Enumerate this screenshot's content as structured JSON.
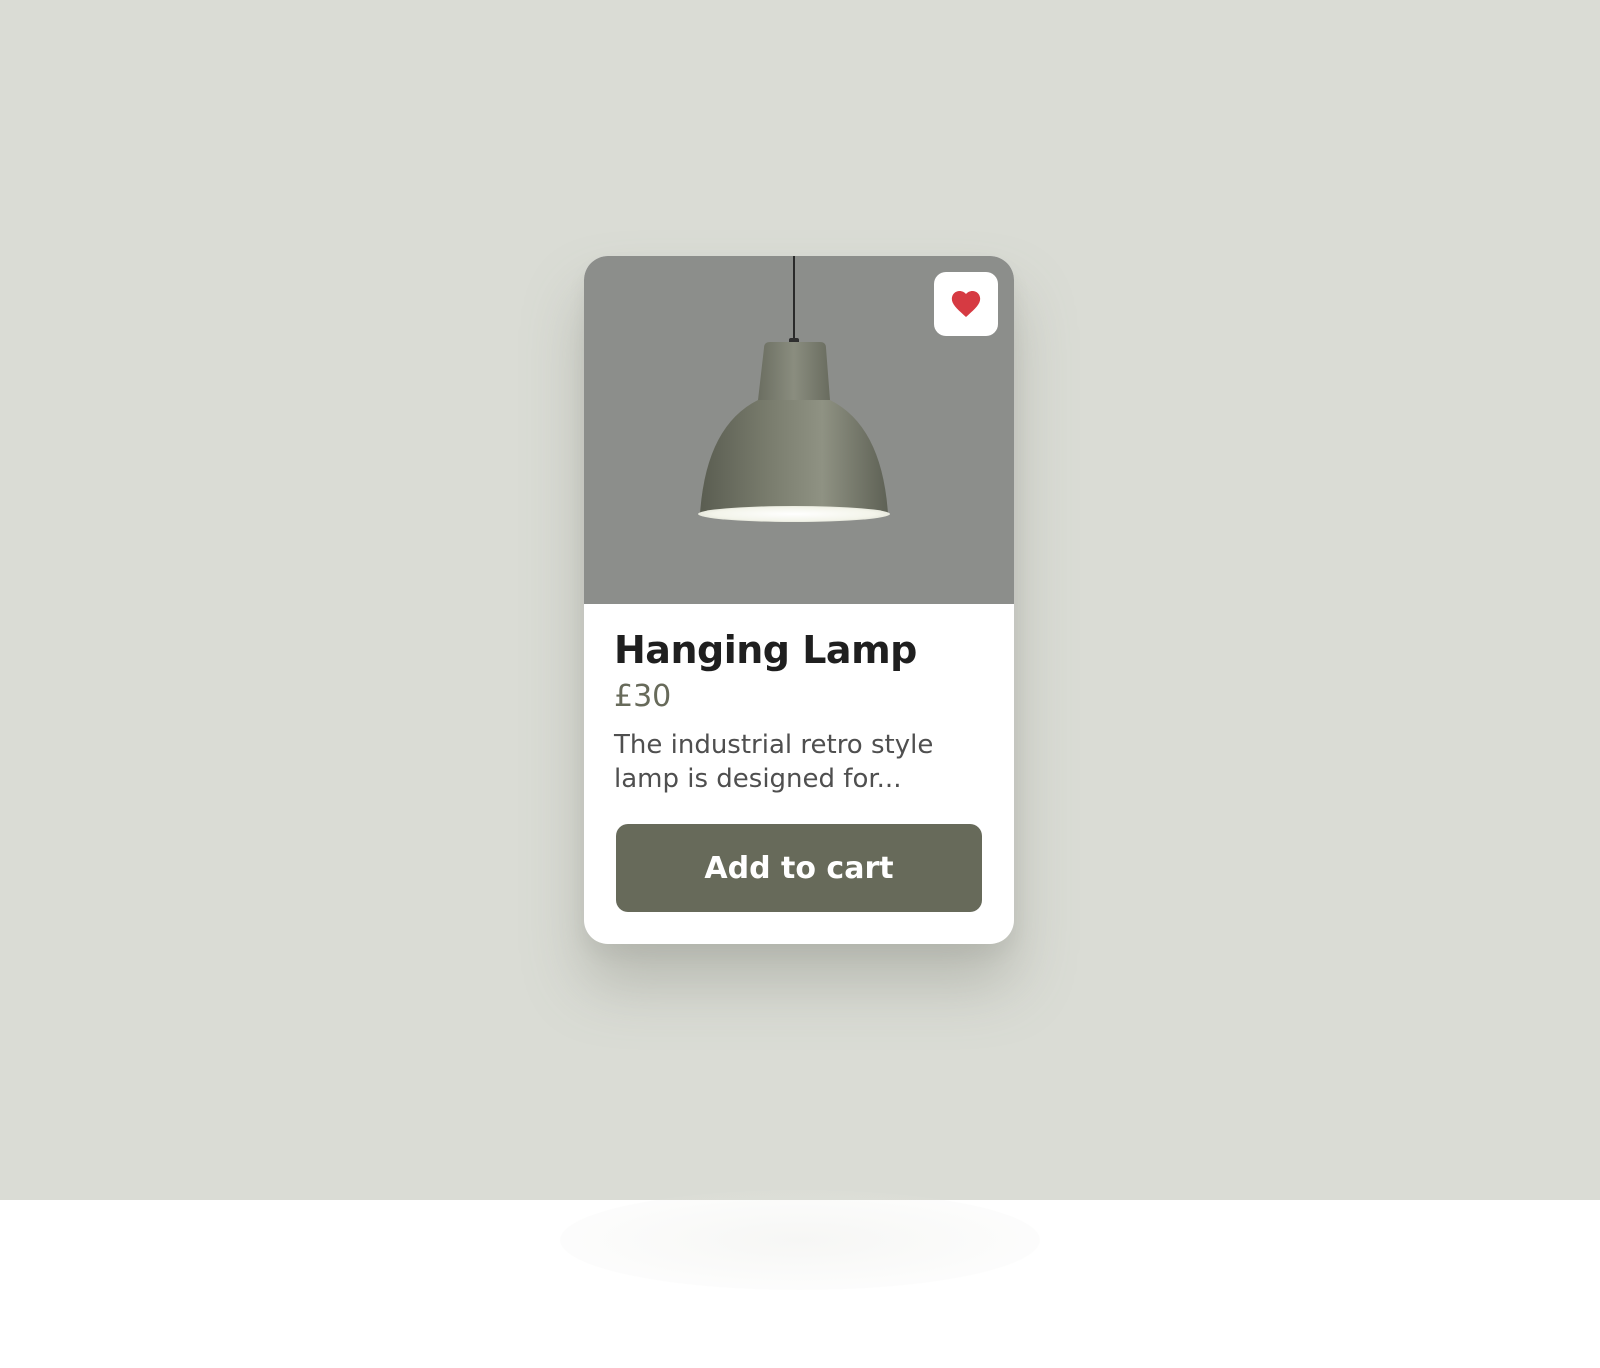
{
  "colors": {
    "page_background": "#dadcd5",
    "card_background": "#ffffff",
    "image_background": "#8c8e8b",
    "accent": "#676a5a",
    "heart": "#d63a42",
    "title_text": "#1f1f1f",
    "body_text": "#4f4f4f"
  },
  "product": {
    "image_subject": "hanging-lamp",
    "favorite_icon": "heart-icon",
    "name": "Hanging Lamp",
    "price": "£30",
    "description": "The industrial retro style lamp is designed for...",
    "cart_label": "Add to cart"
  }
}
